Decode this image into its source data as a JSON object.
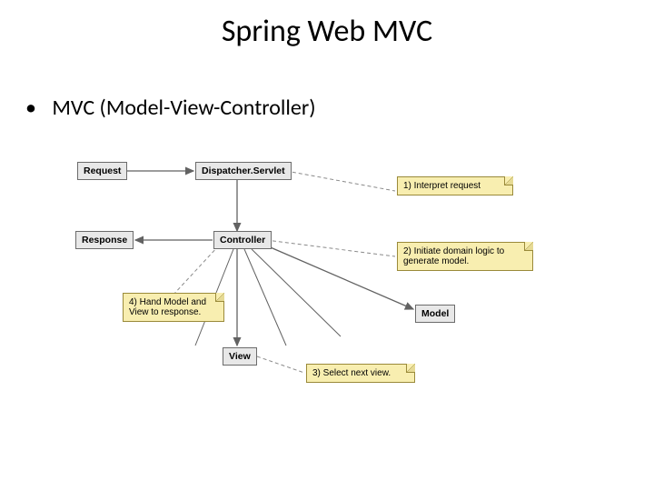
{
  "title": "Spring Web MVC",
  "subtitle": "MVC (Model-View-Controller)",
  "boxes": {
    "request": "Request",
    "dispatcher": "Dispatcher.Servlet",
    "response": "Response",
    "controller": "Controller",
    "model": "Model",
    "view": "View"
  },
  "notes": {
    "n1": "1) Interpret request",
    "n2": "2) Initiate domain logic to generate model.",
    "n3": "3) Select next view.",
    "n4": "4) Hand Model and View to response."
  }
}
